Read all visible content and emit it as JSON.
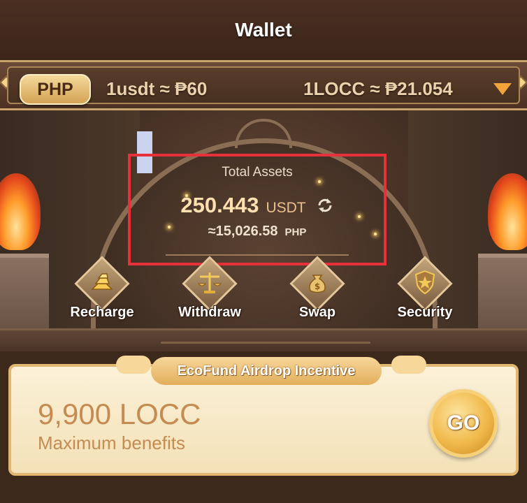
{
  "header": {
    "title": "Wallet"
  },
  "rate_bar": {
    "currency": "PHP",
    "usdt_rate": "1usdt ≈ ₱60",
    "locc_rate": "1LOCC ≈ ₱21.054",
    "dropdown_icon": "triangle-down-icon"
  },
  "assets": {
    "label": "Total Assets",
    "value": "250.443",
    "unit": "USDT",
    "approx_value": "≈15,026.58",
    "approx_unit": "PHP",
    "refresh_icon": "refresh-icon"
  },
  "actions": [
    {
      "label": "Recharge",
      "icon": "gold-bars-icon"
    },
    {
      "label": "Withdraw",
      "icon": "scales-icon"
    },
    {
      "label": "Swap",
      "icon": "money-bag-icon"
    },
    {
      "label": "Security",
      "icon": "shield-icon"
    }
  ],
  "airdrop": {
    "banner": "EcoFund Airdrop Incentive",
    "amount": "9,900 LOCC",
    "caption": "Maximum benefits",
    "go_label": "GO"
  },
  "colors": {
    "highlight_border": "#e8303a",
    "accent_gold": "#f0b94a",
    "dropdown_orange": "#f2a33a"
  }
}
